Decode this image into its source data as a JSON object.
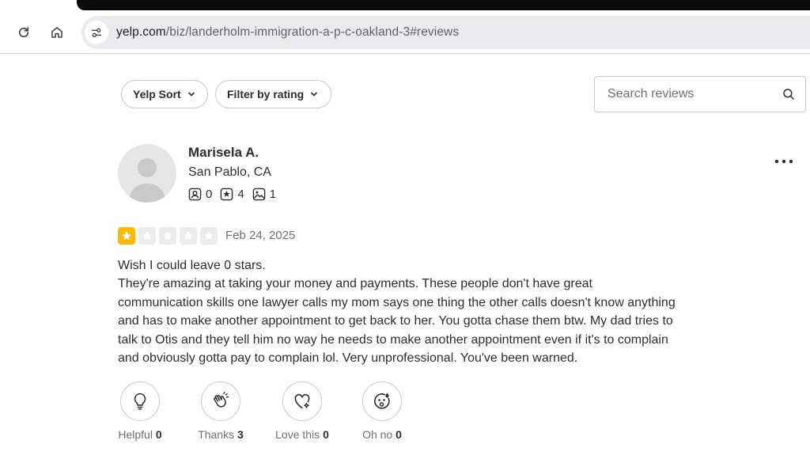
{
  "browser": {
    "url_host": "yelp.com",
    "url_path": "/biz/landerholm-immigration-a-p-c-oakland-3#reviews"
  },
  "filters": {
    "sort_label": "Yelp Sort",
    "rating_label": "Filter by rating",
    "search_placeholder": "Search reviews"
  },
  "review": {
    "user": {
      "name": "Marisela A.",
      "location": "San Pablo, CA",
      "friends": "0",
      "reviews": "4",
      "photos": "1"
    },
    "rating": 1,
    "rating_color": "#fdb900",
    "date": "Feb 24, 2025",
    "text": [
      "Wish I could leave 0 stars.",
      "They're amazing at taking your money and payments. These people don't have great",
      "communication skills one lawyer calls my mom says one thing the other calls doesn't know anything",
      "and has to make another appointment to get back to her. You gotta chase them btw. My dad tries to",
      "talk to Otis and they tell him no way he needs to make another appointment even if it's to complain",
      "and obviously gotta pay to complain lol. Very unprofessional. You've been warned."
    ],
    "reactions": [
      {
        "label": "Helpful",
        "count": "0",
        "icon": "lightbulb-icon"
      },
      {
        "label": "Thanks",
        "count": "3",
        "icon": "clapping-hands-icon"
      },
      {
        "label": "Love this",
        "count": "0",
        "icon": "heart-sparkle-icon"
      },
      {
        "label": "Oh no",
        "count": "0",
        "icon": "oh-no-face-icon"
      }
    ]
  }
}
